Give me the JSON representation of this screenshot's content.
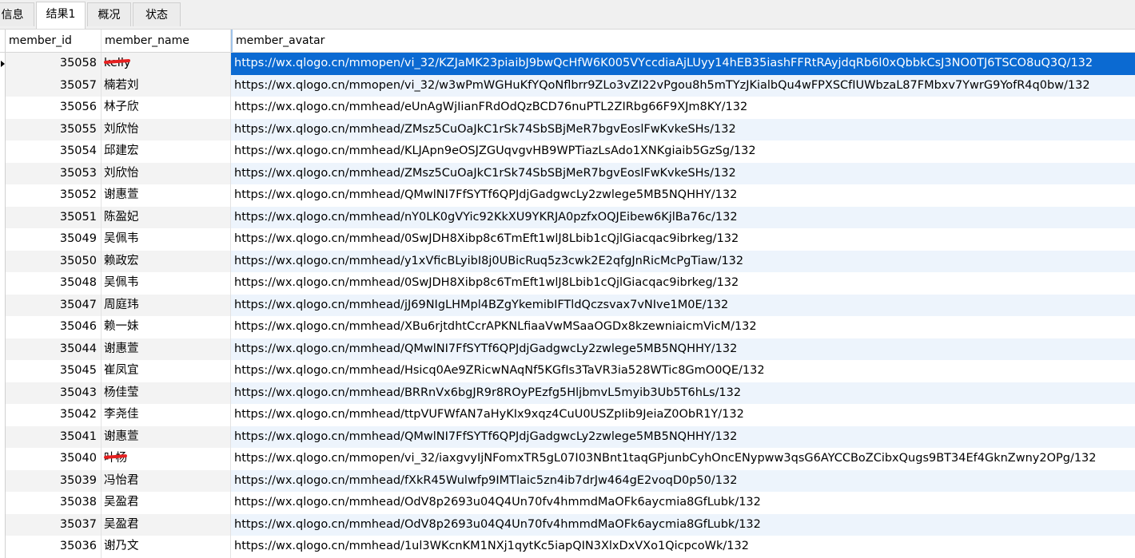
{
  "tabs": [
    {
      "label": "信息",
      "active": false
    },
    {
      "label": "结果1",
      "active": true
    },
    {
      "label": "概况",
      "active": false
    },
    {
      "label": "状态",
      "active": false
    }
  ],
  "columns": [
    "member_id",
    "member_name",
    "member_avatar"
  ],
  "rows": [
    {
      "id": "35058",
      "name": "kelly",
      "url": "https://wx.qlogo.cn/mmopen/vi_32/KZJaMK23piaibJ9bwQcHfW6K005VYccdiaAjLUyy14hEB35iashFFRtRAyjdqRb6l0xQbbkCsJ3NO0TJ6TSCO8uQ3Q/132"
    },
    {
      "id": "35057",
      "name": "楠若刘",
      "url": "https://wx.qlogo.cn/mmopen/vi_32/w3wPmWGHuKfYQoNflbrr9ZLo3vZI22vPgou8h5mTYzJKialbQu4wFPXSCfIUWbzaL87FMbxv7YwrG9YofR4q0bw/132"
    },
    {
      "id": "35056",
      "name": "林子欣",
      "url": "https://wx.qlogo.cn/mmhead/eUnAgWjIianFRdOdQzBCD76nuPTL2ZIRbg66F9XJm8KY/132"
    },
    {
      "id": "35055",
      "name": "刘欣怡",
      "url": "https://wx.qlogo.cn/mmhead/ZMsz5CuOaJkC1rSk74SbSBjMeR7bgvEoslFwKvkeSHs/132"
    },
    {
      "id": "35054",
      "name": "邱建宏",
      "url": "https://wx.qlogo.cn/mmhead/KLJApn9eOSJZGUqvgvHB9WPTiazLsAdo1XNKgiaib5GzSg/132"
    },
    {
      "id": "35053",
      "name": "刘欣怡",
      "url": "https://wx.qlogo.cn/mmhead/ZMsz5CuOaJkC1rSk74SbSBjMeR7bgvEoslFwKvkeSHs/132"
    },
    {
      "id": "35052",
      "name": "谢惠萱",
      "url": "https://wx.qlogo.cn/mmhead/QMwlNI7FfSYTf6QPJdjGadgwcLy2zwlege5MB5NQHHY/132"
    },
    {
      "id": "35051",
      "name": "陈盈妃",
      "url": "https://wx.qlogo.cn/mmhead/nY0LK0gVYic92KkXU9YKRJA0pzfxOQJEibew6KjlBa76c/132"
    },
    {
      "id": "35049",
      "name": "吴佩韦",
      "url": "https://wx.qlogo.cn/mmhead/0SwJDH8Xibp8c6TmEft1wlJ8Lbib1cQjlGiacqac9ibrkeg/132"
    },
    {
      "id": "35050",
      "name": "赖政宏",
      "url": "https://wx.qlogo.cn/mmhead/y1xVficBLyibI8j0UBicRuq5z3cwk2E2qfgJnRicMcPgTiaw/132"
    },
    {
      "id": "35048",
      "name": "吴佩韦",
      "url": "https://wx.qlogo.cn/mmhead/0SwJDH8Xibp8c6TmEft1wlJ8Lbib1cQjlGiacqac9ibrkeg/132"
    },
    {
      "id": "35047",
      "name": "周庭玮",
      "url": "https://wx.qlogo.cn/mmhead/jJ69NIgLHMpl4BZgYkemibIFTldQczsvax7vNIve1M0E/132"
    },
    {
      "id": "35046",
      "name": "赖一妹",
      "url": "https://wx.qlogo.cn/mmhead/XBu6rjtdhtCcrAPKNLfiaaVwMSaaOGDx8kzewniaicmVicM/132"
    },
    {
      "id": "35044",
      "name": "谢惠萱",
      "url": "https://wx.qlogo.cn/mmhead/QMwlNI7FfSYTf6QPJdjGadgwcLy2zwlege5MB5NQHHY/132"
    },
    {
      "id": "35045",
      "name": "崔凤宜",
      "url": "https://wx.qlogo.cn/mmhead/Hsicq0Ae9ZRicwNAqNf5KGfIs3TaVR3ia528WTic8GmO0QE/132"
    },
    {
      "id": "35043",
      "name": "杨佳莹",
      "url": "https://wx.qlogo.cn/mmhead/BRRnVx6bgJR9r8ROyPEzfg5HljbmvL5myib3Ub5T6hLs/132"
    },
    {
      "id": "35042",
      "name": "李尧佳",
      "url": "https://wx.qlogo.cn/mmhead/ttpVUFWfAN7aHyKIx9xqz4CuU0USZpIib9JeiaZ0ObR1Y/132"
    },
    {
      "id": "35041",
      "name": "谢惠萱",
      "url": "https://wx.qlogo.cn/mmhead/QMwlNI7FfSYTf6QPJdjGadgwcLy2zwlege5MB5NQHHY/132"
    },
    {
      "id": "35040",
      "name": "叶杨",
      "url": "https://wx.qlogo.cn/mmopen/vi_32/iaxgvyIjNFomxTR5gL07I03NBnt1taqGPjunbCyhOncENypww3qsG6AYCCBoZCibxQugs9BT34Ef4GknZwny2OPg/132"
    },
    {
      "id": "35039",
      "name": "冯怡君",
      "url": "https://wx.qlogo.cn/mmhead/fXkR45Wulwfp9IMTlaic5zn4ib7drJw464gE2voqD0p50/132"
    },
    {
      "id": "35038",
      "name": "吴盈君",
      "url": "https://wx.qlogo.cn/mmhead/OdV8p2693u04Q4Un70fv4hmmdMaOFk6aycmia8GfLubk/132"
    },
    {
      "id": "35037",
      "name": "吴盈君",
      "url": "https://wx.qlogo.cn/mmhead/OdV8p2693u04Q4Un70fv4hmmdMaOFk6aycmia8GfLubk/132"
    },
    {
      "id": "35036",
      "name": "谢乃文",
      "url": "https://wx.qlogo.cn/mmhead/1ul3WKcnKM1NXj1qytKc5iapQIN3XlxDxVXo1QicpcoWk/132"
    }
  ]
}
